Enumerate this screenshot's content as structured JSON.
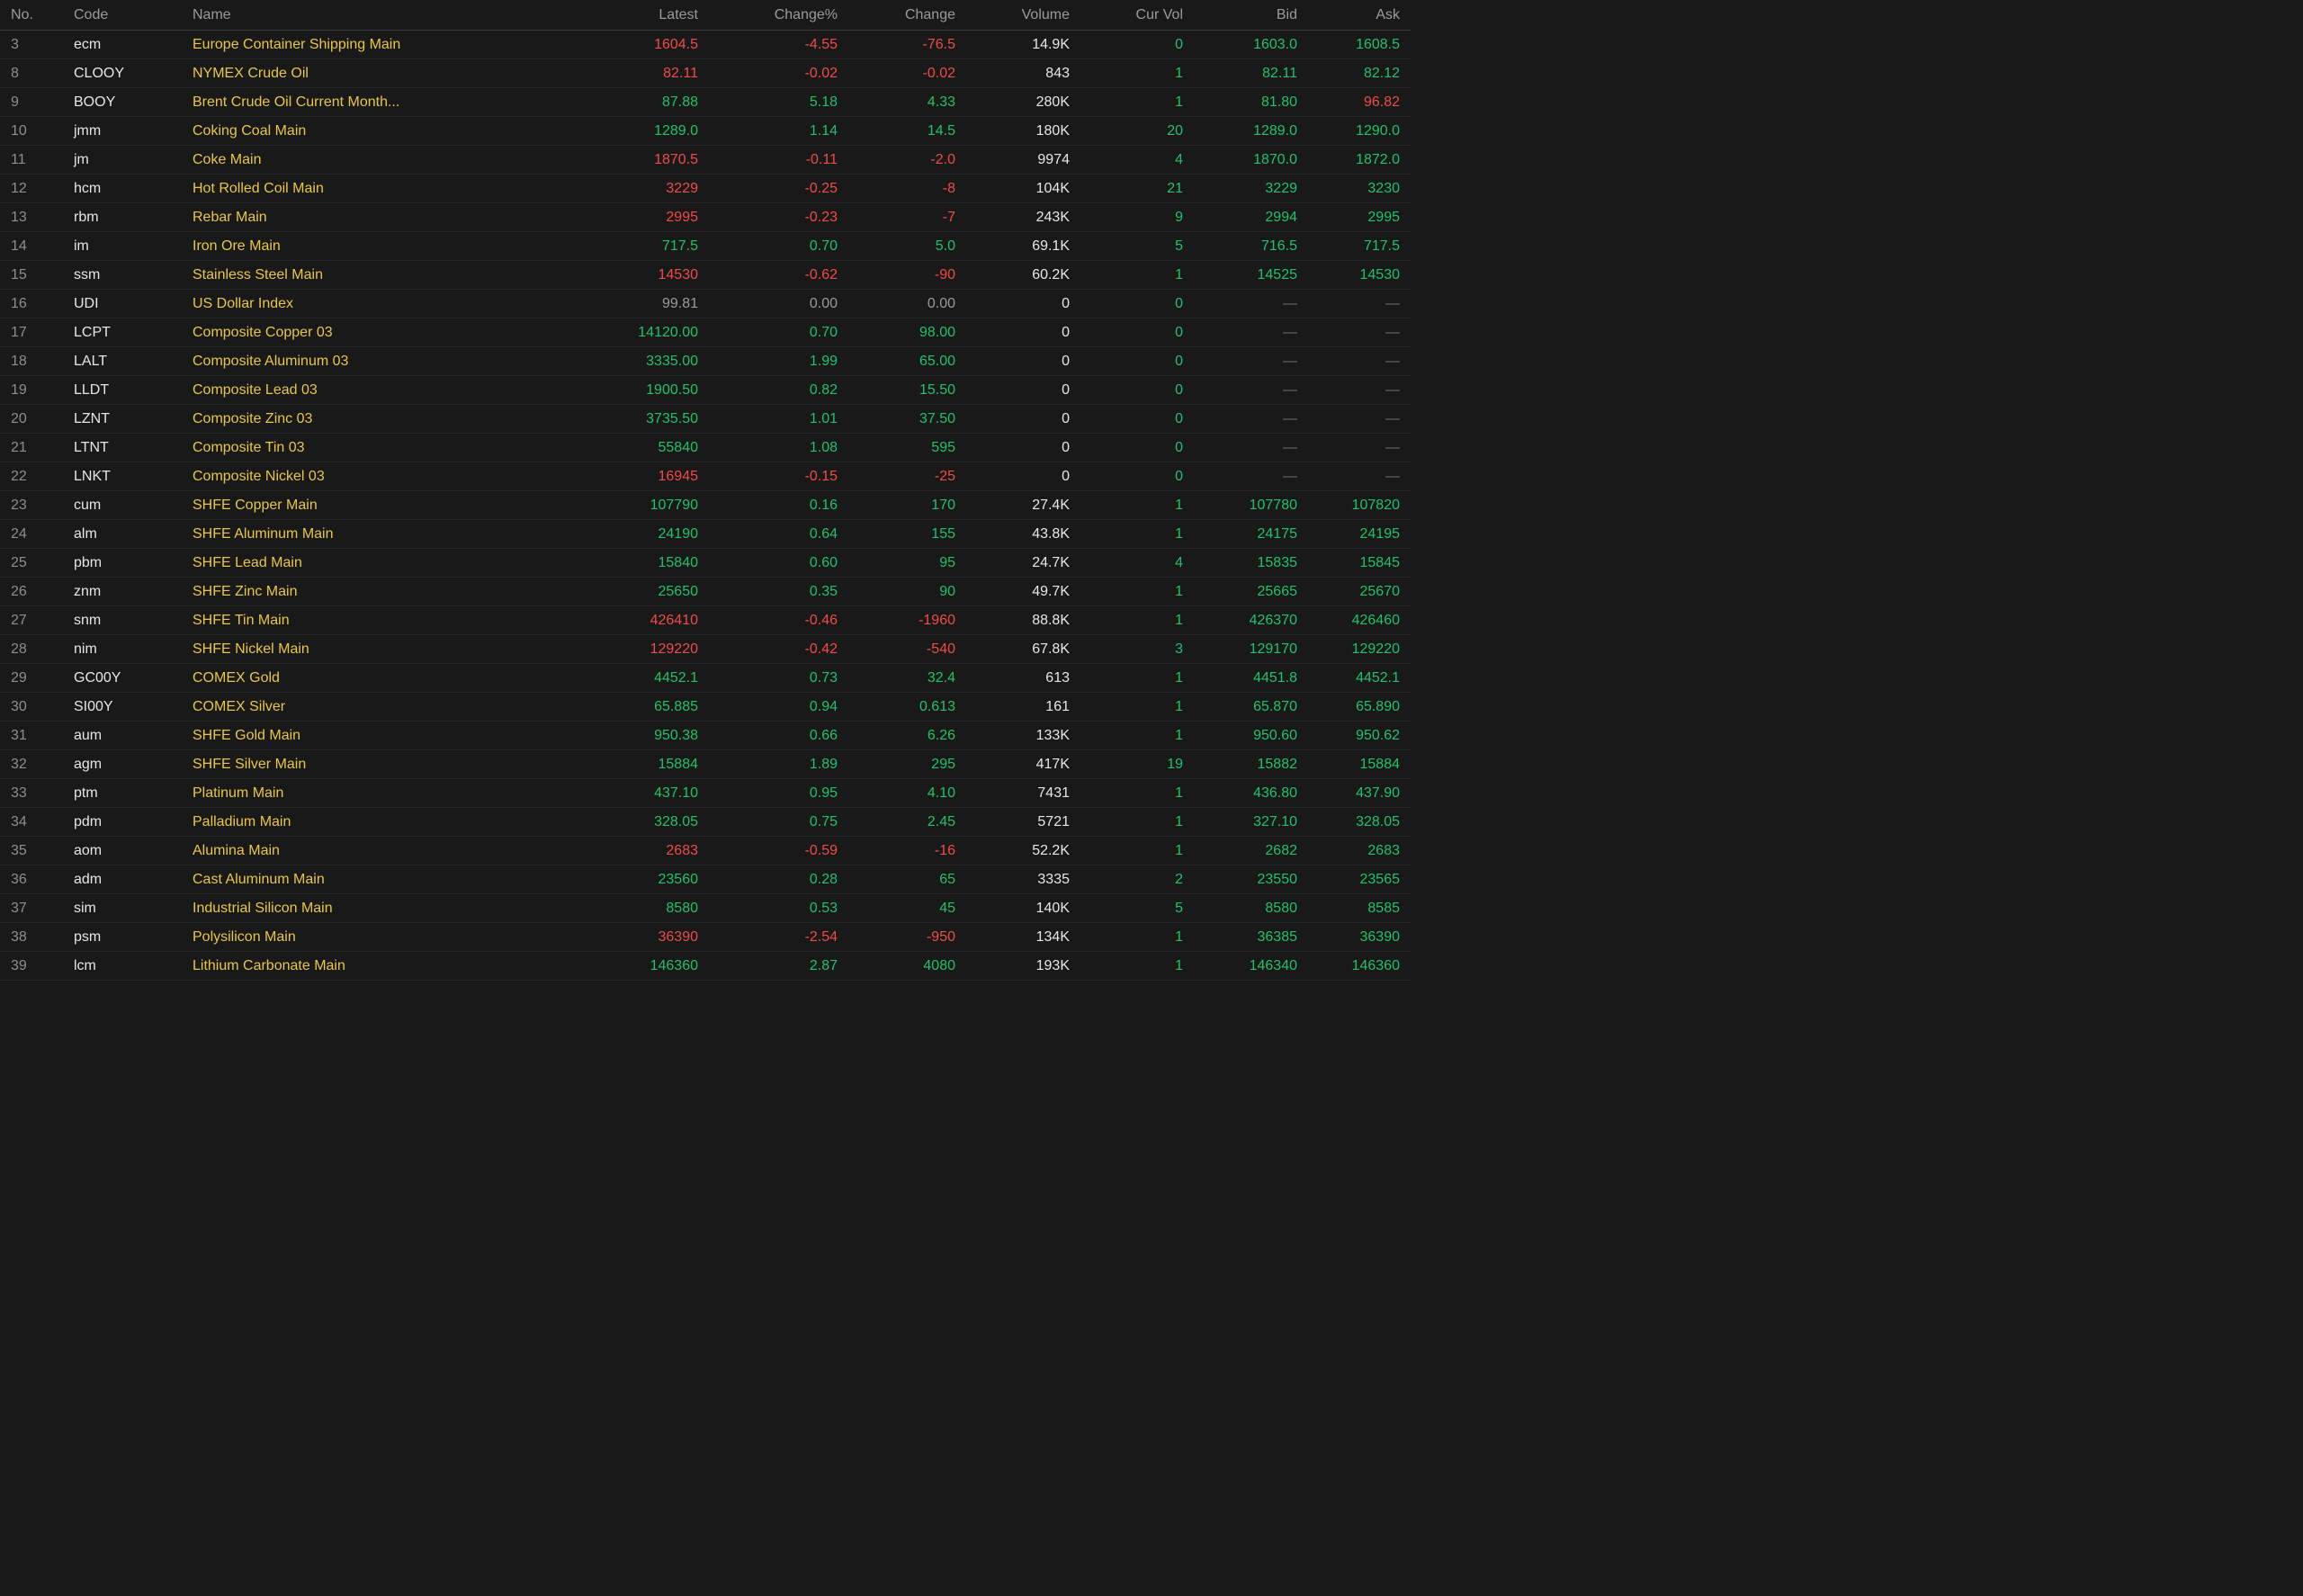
{
  "columns": {
    "no": "No.",
    "code": "Code",
    "name": "Name",
    "latest": "Latest",
    "change_pct": "Change%",
    "change": "Change",
    "volume": "Volume",
    "cur_vol": "Cur Vol",
    "bid": "Bid",
    "ask": "Ask"
  },
  "colors": {
    "up": "#22c26a",
    "down": "#f04a4a",
    "flat": "#9a9a9a",
    "name": "#e9c64a",
    "background": "#191919"
  },
  "rows": [
    {
      "no": "3",
      "code": "ecm",
      "name": "Europe Container Shipping Main",
      "latest": "1604.5",
      "change_pct": "-4.55",
      "change": "-76.5",
      "volume": "14.9K",
      "cur_vol": "0",
      "bid": "1603.0",
      "ask": "1608.5",
      "trend": "down",
      "bid_trend": "up",
      "ask_trend": "up"
    },
    {
      "no": "8",
      "code": "CLOOY",
      "name": "NYMEX Crude Oil",
      "latest": "82.11",
      "change_pct": "-0.02",
      "change": "-0.02",
      "volume": "843",
      "cur_vol": "1",
      "bid": "82.11",
      "ask": "82.12",
      "trend": "down",
      "bid_trend": "up",
      "ask_trend": "up"
    },
    {
      "no": "9",
      "code": "BOOY",
      "name": "Brent Crude Oil Current Month...",
      "latest": "87.88",
      "change_pct": "5.18",
      "change": "4.33",
      "volume": "280K",
      "cur_vol": "1",
      "bid": "81.80",
      "ask": "96.82",
      "trend": "up",
      "bid_trend": "up",
      "ask_trend": "down"
    },
    {
      "no": "10",
      "code": "jmm",
      "name": "Coking Coal Main",
      "latest": "1289.0",
      "change_pct": "1.14",
      "change": "14.5",
      "volume": "180K",
      "cur_vol": "20",
      "bid": "1289.0",
      "ask": "1290.0",
      "trend": "up",
      "bid_trend": "up",
      "ask_trend": "up"
    },
    {
      "no": "11",
      "code": "jm",
      "name": "Coke Main",
      "latest": "1870.5",
      "change_pct": "-0.11",
      "change": "-2.0",
      "volume": "9974",
      "cur_vol": "4",
      "bid": "1870.0",
      "ask": "1872.0",
      "trend": "down",
      "bid_trend": "up",
      "ask_trend": "up"
    },
    {
      "no": "12",
      "code": "hcm",
      "name": "Hot Rolled Coil Main",
      "latest": "3229",
      "change_pct": "-0.25",
      "change": "-8",
      "volume": "104K",
      "cur_vol": "21",
      "bid": "3229",
      "ask": "3230",
      "trend": "down",
      "bid_trend": "up",
      "ask_trend": "up"
    },
    {
      "no": "13",
      "code": "rbm",
      "name": "Rebar Main",
      "latest": "2995",
      "change_pct": "-0.23",
      "change": "-7",
      "volume": "243K",
      "cur_vol": "9",
      "bid": "2994",
      "ask": "2995",
      "trend": "down",
      "bid_trend": "up",
      "ask_trend": "up"
    },
    {
      "no": "14",
      "code": "im",
      "name": "Iron Ore Main",
      "latest": "717.5",
      "change_pct": "0.70",
      "change": "5.0",
      "volume": "69.1K",
      "cur_vol": "5",
      "bid": "716.5",
      "ask": "717.5",
      "trend": "up",
      "bid_trend": "up",
      "ask_trend": "up"
    },
    {
      "no": "15",
      "code": "ssm",
      "name": "Stainless Steel Main",
      "latest": "14530",
      "change_pct": "-0.62",
      "change": "-90",
      "volume": "60.2K",
      "cur_vol": "1",
      "bid": "14525",
      "ask": "14530",
      "trend": "down",
      "bid_trend": "up",
      "ask_trend": "up"
    },
    {
      "no": "16",
      "code": "UDI",
      "name": "US Dollar Index",
      "latest": "99.81",
      "change_pct": "0.00",
      "change": "0.00",
      "volume": "0",
      "cur_vol": "0",
      "bid": "—",
      "ask": "—",
      "trend": "flat",
      "bid_trend": "dash",
      "ask_trend": "dash"
    },
    {
      "no": "17",
      "code": "LCPT",
      "name": "Composite Copper 03",
      "latest": "14120.00",
      "change_pct": "0.70",
      "change": "98.00",
      "volume": "0",
      "cur_vol": "0",
      "bid": "—",
      "ask": "—",
      "trend": "up",
      "bid_trend": "dash",
      "ask_trend": "dash"
    },
    {
      "no": "18",
      "code": "LALT",
      "name": "Composite Aluminum 03",
      "latest": "3335.00",
      "change_pct": "1.99",
      "change": "65.00",
      "volume": "0",
      "cur_vol": "0",
      "bid": "—",
      "ask": "—",
      "trend": "up",
      "bid_trend": "dash",
      "ask_trend": "dash"
    },
    {
      "no": "19",
      "code": "LLDT",
      "name": "Composite Lead 03",
      "latest": "1900.50",
      "change_pct": "0.82",
      "change": "15.50",
      "volume": "0",
      "cur_vol": "0",
      "bid": "—",
      "ask": "—",
      "trend": "up",
      "bid_trend": "dash",
      "ask_trend": "dash"
    },
    {
      "no": "20",
      "code": "LZNT",
      "name": "Composite Zinc 03",
      "latest": "3735.50",
      "change_pct": "1.01",
      "change": "37.50",
      "volume": "0",
      "cur_vol": "0",
      "bid": "—",
      "ask": "—",
      "trend": "up",
      "bid_trend": "dash",
      "ask_trend": "dash"
    },
    {
      "no": "21",
      "code": "LTNT",
      "name": "Composite Tin 03",
      "latest": "55840",
      "change_pct": "1.08",
      "change": "595",
      "volume": "0",
      "cur_vol": "0",
      "bid": "—",
      "ask": "—",
      "trend": "up",
      "bid_trend": "dash",
      "ask_trend": "dash"
    },
    {
      "no": "22",
      "code": "LNKT",
      "name": "Composite Nickel 03",
      "latest": "16945",
      "change_pct": "-0.15",
      "change": "-25",
      "volume": "0",
      "cur_vol": "0",
      "bid": "—",
      "ask": "—",
      "trend": "down",
      "bid_trend": "dash",
      "ask_trend": "dash"
    },
    {
      "no": "23",
      "code": "cum",
      "name": "SHFE Copper Main",
      "latest": "107790",
      "change_pct": "0.16",
      "change": "170",
      "volume": "27.4K",
      "cur_vol": "1",
      "bid": "107780",
      "ask": "107820",
      "trend": "up",
      "bid_trend": "up",
      "ask_trend": "up"
    },
    {
      "no": "24",
      "code": "alm",
      "name": "SHFE Aluminum Main",
      "latest": "24190",
      "change_pct": "0.64",
      "change": "155",
      "volume": "43.8K",
      "cur_vol": "1",
      "bid": "24175",
      "ask": "24195",
      "trend": "up",
      "bid_trend": "up",
      "ask_trend": "up"
    },
    {
      "no": "25",
      "code": "pbm",
      "name": "SHFE Lead Main",
      "latest": "15840",
      "change_pct": "0.60",
      "change": "95",
      "volume": "24.7K",
      "cur_vol": "4",
      "bid": "15835",
      "ask": "15845",
      "trend": "up",
      "bid_trend": "up",
      "ask_trend": "up"
    },
    {
      "no": "26",
      "code": "znm",
      "name": "SHFE Zinc Main",
      "latest": "25650",
      "change_pct": "0.35",
      "change": "90",
      "volume": "49.7K",
      "cur_vol": "1",
      "bid": "25665",
      "ask": "25670",
      "trend": "up",
      "bid_trend": "up",
      "ask_trend": "up"
    },
    {
      "no": "27",
      "code": "snm",
      "name": "SHFE Tin Main",
      "latest": "426410",
      "change_pct": "-0.46",
      "change": "-1960",
      "volume": "88.8K",
      "cur_vol": "1",
      "bid": "426370",
      "ask": "426460",
      "trend": "down",
      "bid_trend": "up",
      "ask_trend": "up"
    },
    {
      "no": "28",
      "code": "nim",
      "name": "SHFE Nickel Main",
      "latest": "129220",
      "change_pct": "-0.42",
      "change": "-540",
      "volume": "67.8K",
      "cur_vol": "3",
      "bid": "129170",
      "ask": "129220",
      "trend": "down",
      "bid_trend": "up",
      "ask_trend": "up"
    },
    {
      "no": "29",
      "code": "GC00Y",
      "name": "COMEX Gold",
      "latest": "4452.1",
      "change_pct": "0.73",
      "change": "32.4",
      "volume": "613",
      "cur_vol": "1",
      "bid": "4451.8",
      "ask": "4452.1",
      "trend": "up",
      "bid_trend": "up",
      "ask_trend": "up"
    },
    {
      "no": "30",
      "code": "SI00Y",
      "name": "COMEX Silver",
      "latest": "65.885",
      "change_pct": "0.94",
      "change": "0.613",
      "volume": "161",
      "cur_vol": "1",
      "bid": "65.870",
      "ask": "65.890",
      "trend": "up",
      "bid_trend": "up",
      "ask_trend": "up"
    },
    {
      "no": "31",
      "code": "aum",
      "name": "SHFE Gold Main",
      "latest": "950.38",
      "change_pct": "0.66",
      "change": "6.26",
      "volume": "133K",
      "cur_vol": "1",
      "bid": "950.60",
      "ask": "950.62",
      "trend": "up",
      "bid_trend": "up",
      "ask_trend": "up"
    },
    {
      "no": "32",
      "code": "agm",
      "name": "SHFE Silver Main",
      "latest": "15884",
      "change_pct": "1.89",
      "change": "295",
      "volume": "417K",
      "cur_vol": "19",
      "bid": "15882",
      "ask": "15884",
      "trend": "up",
      "bid_trend": "up",
      "ask_trend": "up"
    },
    {
      "no": "33",
      "code": "ptm",
      "name": "Platinum Main",
      "latest": "437.10",
      "change_pct": "0.95",
      "change": "4.10",
      "volume": "7431",
      "cur_vol": "1",
      "bid": "436.80",
      "ask": "437.90",
      "trend": "up",
      "bid_trend": "up",
      "ask_trend": "up"
    },
    {
      "no": "34",
      "code": "pdm",
      "name": "Palladium Main",
      "latest": "328.05",
      "change_pct": "0.75",
      "change": "2.45",
      "volume": "5721",
      "cur_vol": "1",
      "bid": "327.10",
      "ask": "328.05",
      "trend": "up",
      "bid_trend": "up",
      "ask_trend": "up"
    },
    {
      "no": "35",
      "code": "aom",
      "name": "Alumina Main",
      "latest": "2683",
      "change_pct": "-0.59",
      "change": "-16",
      "volume": "52.2K",
      "cur_vol": "1",
      "bid": "2682",
      "ask": "2683",
      "trend": "down",
      "bid_trend": "up",
      "ask_trend": "up"
    },
    {
      "no": "36",
      "code": "adm",
      "name": "Cast Aluminum Main",
      "latest": "23560",
      "change_pct": "0.28",
      "change": "65",
      "volume": "3335",
      "cur_vol": "2",
      "bid": "23550",
      "ask": "23565",
      "trend": "up",
      "bid_trend": "up",
      "ask_trend": "up"
    },
    {
      "no": "37",
      "code": "sim",
      "name": "Industrial Silicon Main",
      "latest": "8580",
      "change_pct": "0.53",
      "change": "45",
      "volume": "140K",
      "cur_vol": "5",
      "bid": "8580",
      "ask": "8585",
      "trend": "up",
      "bid_trend": "up",
      "ask_trend": "up"
    },
    {
      "no": "38",
      "code": "psm",
      "name": "Polysilicon Main",
      "latest": "36390",
      "change_pct": "-2.54",
      "change": "-950",
      "volume": "134K",
      "cur_vol": "1",
      "bid": "36385",
      "ask": "36390",
      "trend": "down",
      "bid_trend": "up",
      "ask_trend": "up"
    },
    {
      "no": "39",
      "code": "lcm",
      "name": "Lithium Carbonate Main",
      "latest": "146360",
      "change_pct": "2.87",
      "change": "4080",
      "volume": "193K",
      "cur_vol": "1",
      "bid": "146340",
      "ask": "146360",
      "trend": "up",
      "bid_trend": "up",
      "ask_trend": "up"
    }
  ]
}
